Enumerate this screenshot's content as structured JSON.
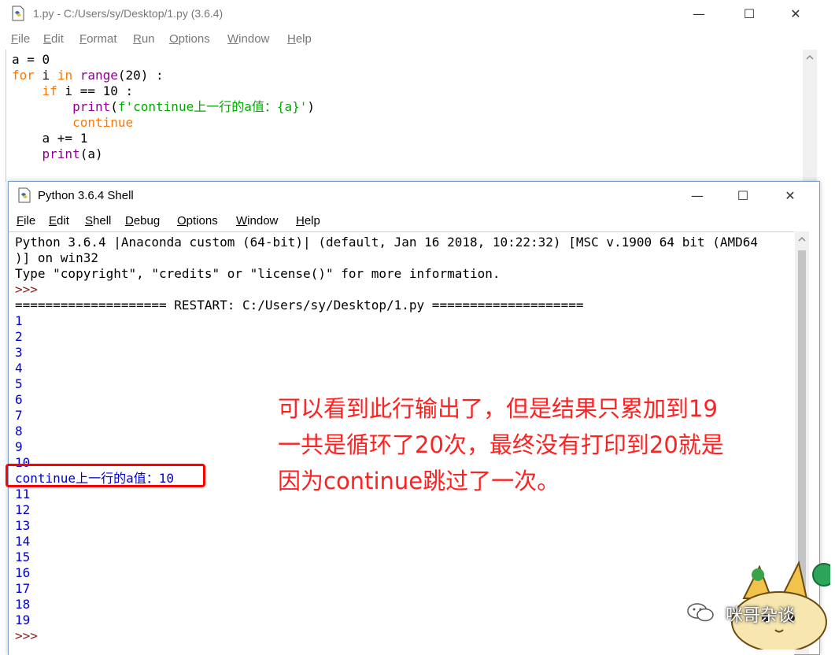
{
  "editor": {
    "title": "1.py - C:/Users/sy/Desktop/1.py (3.6.4)",
    "menu": [
      {
        "label": "File",
        "u": "F",
        "rest": "ile"
      },
      {
        "label": "Edit",
        "u": "E",
        "rest": "dit"
      },
      {
        "label": "Format",
        "u": "F",
        "rest": "ormat"
      },
      {
        "label": "Run",
        "u": "R",
        "rest": "un"
      },
      {
        "label": "Options",
        "u": "O",
        "rest": "ptions"
      },
      {
        "label": "Window",
        "u": "W",
        "rest": "indow"
      },
      {
        "label": "Help",
        "u": "H",
        "rest": "elp"
      }
    ],
    "code": [
      "a = 0",
      "for i in range(20) :",
      "    if i == 10 :",
      "        print(f'continue上一行的a值：{a}')",
      "        continue",
      "    a += 1",
      "    print(a)"
    ]
  },
  "shell": {
    "title": "Python 3.6.4 Shell",
    "menu": [
      {
        "label": "File",
        "u": "F",
        "rest": "ile"
      },
      {
        "label": "Edit",
        "u": "E",
        "rest": "dit"
      },
      {
        "label": "Shell",
        "u": "S",
        "rest": "hell"
      },
      {
        "label": "Debug",
        "u": "D",
        "rest": "ebug"
      },
      {
        "label": "Options",
        "u": "O",
        "rest": "ptions"
      },
      {
        "label": "Window",
        "u": "W",
        "rest": "indow"
      },
      {
        "label": "Help",
        "u": "H",
        "rest": "elp"
      }
    ],
    "banner1": "Python 3.6.4 |Anaconda custom (64-bit)| (default, Jan 16 2018, 10:22:32) [MSC v.1900 64 bit (AMD64",
    "banner2": ")] on win32",
    "banner3": "Type \"copyright\", \"credits\" or \"license()\" for more information.",
    "prompt": ">>>",
    "restart": "==================== RESTART: C:/Users/sy/Desktop/1.py ====================",
    "output_before": [
      "1",
      "2",
      "3",
      "4",
      "5",
      "6",
      "7",
      "8",
      "9",
      "10"
    ],
    "continue_line": "continue上一行的a值：10",
    "output_after": [
      "11",
      "12",
      "13",
      "14",
      "15",
      "16",
      "17",
      "18",
      "19"
    ],
    "final_prompt": ">>>"
  },
  "annotation": {
    "lines": [
      "可以看到此行输出了，但是结果只累加到19",
      "一共是循环了20次，最终没有打印到20就是",
      "因为continue跳过了一次。"
    ],
    "color": "#ff2020"
  },
  "watermark": "咪哥杂谈",
  "window_buttons": {
    "minimize": "—",
    "maximize": "☐",
    "close": "✕"
  }
}
